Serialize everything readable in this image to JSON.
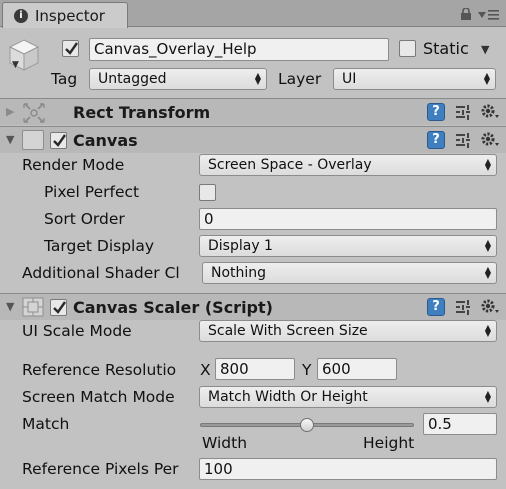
{
  "tab": {
    "icon": "i",
    "label": "Inspector"
  },
  "gameobject": {
    "name": "Canvas_Overlay_Help",
    "static_label": "Static",
    "tag_label": "Tag",
    "tag_value": "Untagged",
    "layer_label": "Layer",
    "layer_value": "UI"
  },
  "rect_transform": {
    "title": "Rect Transform"
  },
  "canvas": {
    "title": "Canvas",
    "render_mode_label": "Render Mode",
    "render_mode_value": "Screen Space - Overlay",
    "pixel_perfect_label": "Pixel Perfect",
    "sort_order_label": "Sort Order",
    "sort_order_value": "0",
    "target_display_label": "Target Display",
    "target_display_value": "Display 1",
    "shader_channels_label": "Additional Shader Cl",
    "shader_channels_value": "Nothing"
  },
  "canvas_scaler": {
    "title": "Canvas Scaler (Script)",
    "ui_scale_mode_label": "UI Scale Mode",
    "ui_scale_mode_value": "Scale With Screen Size",
    "ref_res_label": "Reference Resolutio",
    "x_label": "X",
    "x_value": "800",
    "y_label": "Y",
    "y_value": "600",
    "match_mode_label": "Screen Match Mode",
    "match_mode_value": "Match Width Or Height",
    "match_label": "Match",
    "match_value": "0.5",
    "match_fraction": 0.5,
    "width_label": "Width",
    "height_label": "Height",
    "ref_pixels_label": "Reference Pixels Per",
    "ref_pixels_value": "100"
  },
  "icons": {
    "help": "?",
    "fold": "▼",
    "fold_collapsed": "▶",
    "dropdown": "▲▼"
  },
  "colors": {
    "help_blue": "#3f7fc0",
    "panel_bg": "#c2c2c2"
  }
}
